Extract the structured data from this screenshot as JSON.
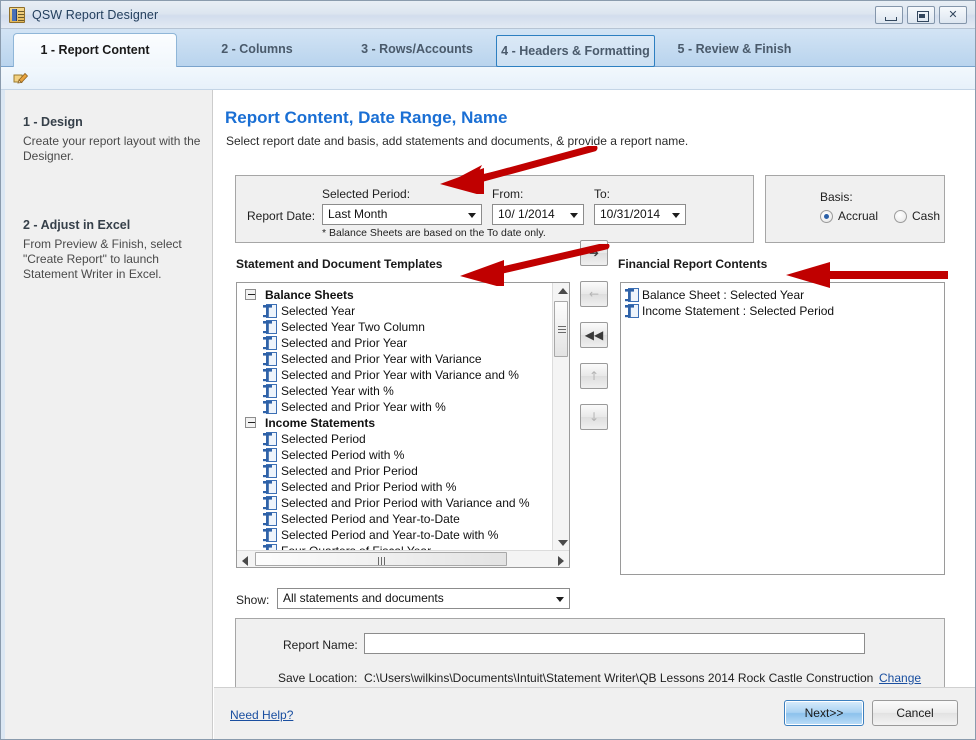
{
  "window": {
    "title": "QSW Report Designer",
    "icon": "report-designer-icon",
    "minimize_label": "Minimize",
    "maximize_label": "Maximize",
    "close_label": "Close"
  },
  "tabs": [
    {
      "label": "1 - Report Content",
      "state": "active"
    },
    {
      "label": "2 - Columns",
      "state": "normal"
    },
    {
      "label": "3 - Rows/Accounts",
      "state": "normal"
    },
    {
      "label": "4 - Headers & Formatting",
      "state": "focused"
    },
    {
      "label": "5 - Review & Finish",
      "state": "normal"
    }
  ],
  "toolbar": {
    "edit_icon": "pencil-edit-icon"
  },
  "sidebar": {
    "steps": [
      {
        "heading": "1 - Design",
        "body": "Create your report layout with the Designer."
      },
      {
        "heading": "2 - Adjust in Excel",
        "body": "From Preview & Finish, select \"Create Report\" to launch Statement Writer in Excel."
      }
    ]
  },
  "main": {
    "title": "Report Content, Date Range,  Name",
    "subtitle": "Select report date and basis, add statements and documents, & provide a report name.",
    "report_date": {
      "row_label": "Report Date:",
      "selected_period_label": "Selected Period:",
      "selected_period_value": "Last Month",
      "from_label": "From:",
      "from_value": "10/  1/2014",
      "to_label": "To:",
      "to_value": "10/31/2014",
      "footnote": "* Balance Sheets are based on the To date only."
    },
    "basis": {
      "label": "Basis:",
      "options": [
        {
          "label": "Accrual",
          "selected": true
        },
        {
          "label": "Cash",
          "selected": false
        }
      ]
    },
    "templates": {
      "heading": "Statement and Document Templates",
      "groups": [
        {
          "name": "Balance Sheets",
          "items": [
            "Selected Year",
            "Selected Year Two Column",
            "Selected and Prior Year",
            "Selected and Prior Year with Variance",
            "Selected and Prior Year with Variance and %",
            "Selected Year with %",
            "Selected and Prior Year with %"
          ]
        },
        {
          "name": "Income Statements",
          "items": [
            "Selected Period",
            "Selected Period with %",
            "Selected and Prior Period",
            "Selected and Prior Period with %",
            "Selected and Prior Period with Variance and %",
            "Selected Period and Year-to-Date",
            "Selected Period and Year-to-Date with %",
            "Four Quarters of Fiscal Year"
          ]
        }
      ],
      "show_label": "Show:",
      "show_value": "All statements and documents"
    },
    "transfer_buttons": [
      {
        "name": "add-button",
        "glyph": "➔",
        "enabled": true
      },
      {
        "name": "remove-button",
        "glyph": "←",
        "enabled": false
      },
      {
        "name": "remove-all-button",
        "glyph": "◀◀",
        "enabled": true
      },
      {
        "name": "move-up-button",
        "glyph": "↑",
        "enabled": false
      },
      {
        "name": "move-down-button",
        "glyph": "↓",
        "enabled": false
      }
    ],
    "contents": {
      "heading": "Financial Report Contents",
      "items": [
        "Balance Sheet : Selected Year",
        "Income Statement : Selected Period"
      ]
    },
    "report_name": {
      "label": "Report Name:",
      "value": "",
      "placeholder": ""
    },
    "save_location": {
      "label": "Save Location:",
      "value": "C:\\Users\\wilkins\\Documents\\Intuit\\Statement Writer\\QB Lessons 2014 Rock Castle Construction",
      "change_label": "Change"
    }
  },
  "footer": {
    "help_label": "Need Help?",
    "next_label": "Next>>",
    "cancel_label": "Cancel"
  },
  "colors": {
    "title_accent": "#1a6fd4",
    "tab_focus": "#2d7fc1",
    "annotation": "#c00000",
    "link": "#1a4fa0"
  }
}
